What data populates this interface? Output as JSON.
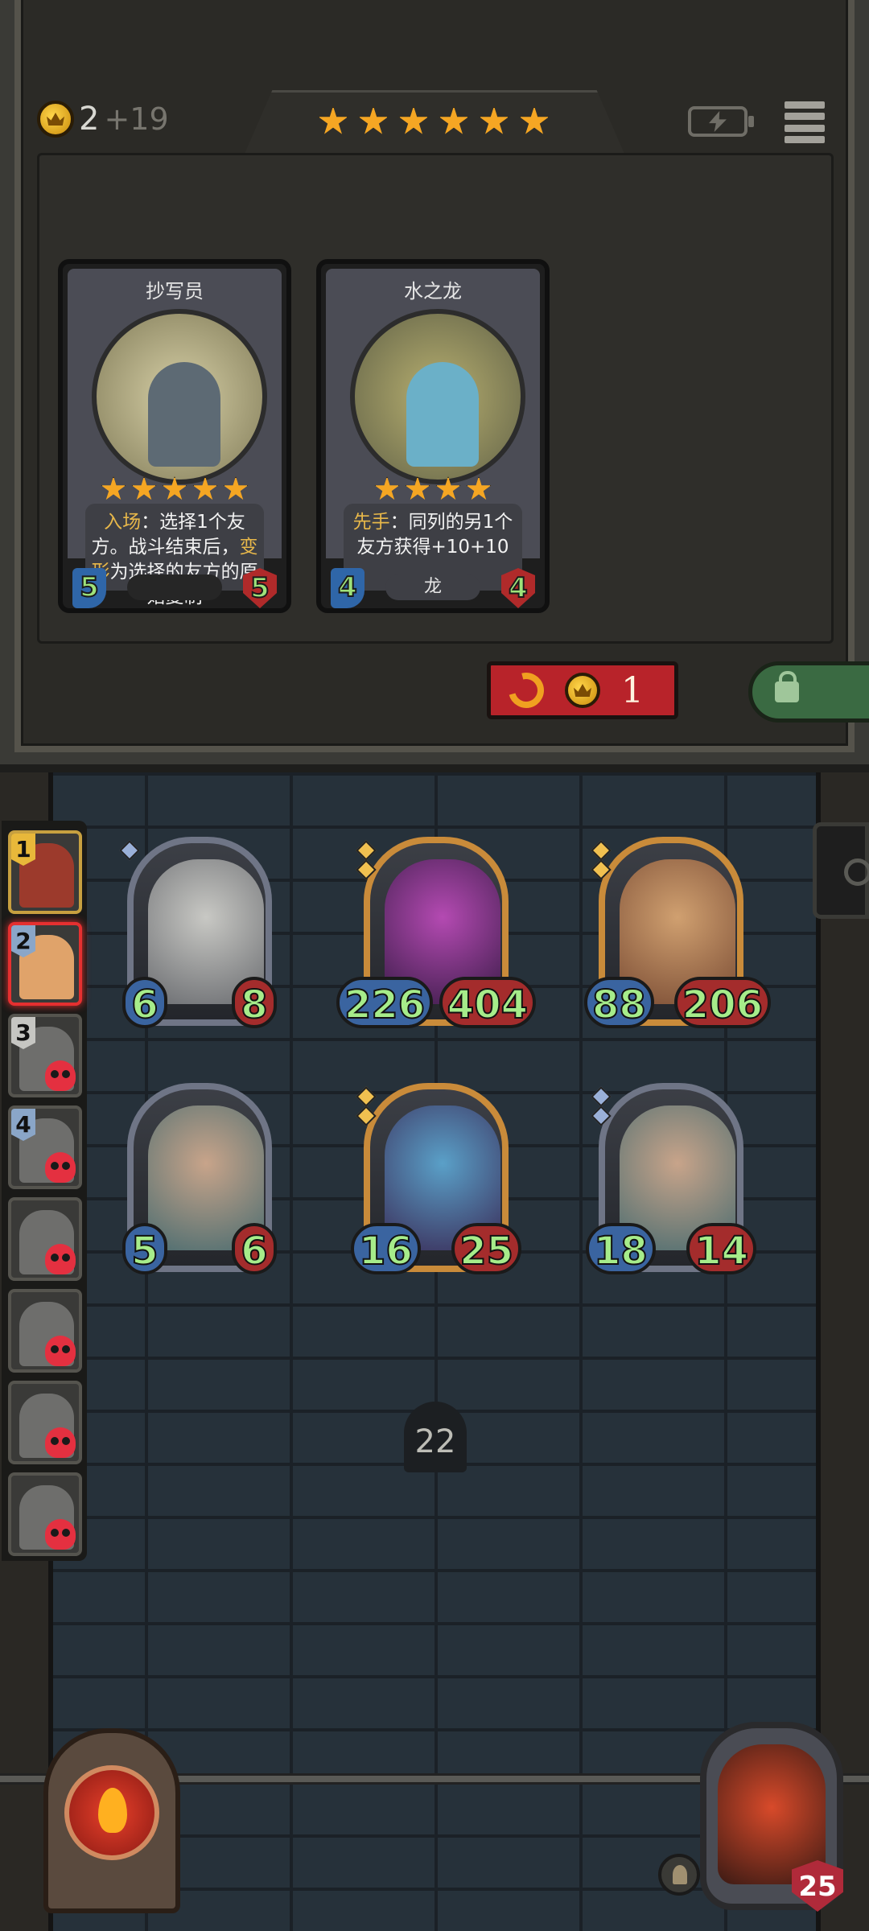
{
  "header": {
    "gold": "2",
    "gold_income": "+19",
    "tavern_tier_stars": 6,
    "icons": [
      "crown-coin-icon",
      "battery-icon",
      "menu-icon"
    ]
  },
  "shop": {
    "cards": [
      {
        "name": "抄写员",
        "stars": 5,
        "text_parts": [
          "入场",
          "：选择1个友方。战斗结束后，",
          "变形",
          "为选择的友方的原始复制"
        ],
        "attack": "5",
        "health": "5",
        "tribe": ""
      },
      {
        "name": "水之龙",
        "stars": 4,
        "text_parts": [
          "先手",
          "：同列的另1个友方获得+10+10"
        ],
        "attack": "4",
        "health": "4",
        "tribe": "龙"
      }
    ],
    "refresh_cost": "1",
    "colors": {
      "keyword": "#e8b84a",
      "refresh": "#b8232a",
      "lock": "#3a6a42"
    }
  },
  "turn_order": [
    {
      "num": "1",
      "state": "first"
    },
    {
      "num": "2",
      "state": "active"
    },
    {
      "num": "3",
      "state": "dead"
    },
    {
      "num": "4",
      "state": "dead"
    },
    {
      "num": "",
      "state": "dead"
    },
    {
      "num": "",
      "state": "dead"
    },
    {
      "num": "",
      "state": "dead"
    },
    {
      "num": "",
      "state": "dead"
    }
  ],
  "board": {
    "front_row": [
      {
        "name": "grey-drake",
        "attack": "6",
        "health": "8",
        "frame": "silver"
      },
      {
        "name": "reaper",
        "attack": "226",
        "health": "404",
        "frame": "gold"
      },
      {
        "name": "red-demon-dragon",
        "attack": "88",
        "health": "206",
        "frame": "gold"
      }
    ],
    "back_row": [
      {
        "name": "horned-beast",
        "attack": "5",
        "health": "6",
        "frame": "silver"
      },
      {
        "name": "elf-witch",
        "attack": "16",
        "health": "25",
        "frame": "gold"
      },
      {
        "name": "horned-beast",
        "attack": "18",
        "health": "14",
        "frame": "silver"
      }
    ],
    "turn": "22"
  },
  "hero": {
    "health": "25"
  }
}
